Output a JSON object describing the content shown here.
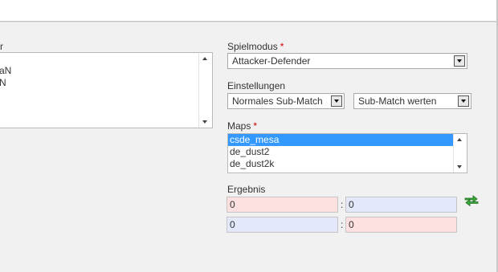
{
  "left_panel": {
    "label": "r",
    "list_items": [
      "",
      "aN",
      "N"
    ]
  },
  "spielmodus": {
    "label": "Spielmodus",
    "required": "*",
    "value": "Attacker-Defender"
  },
  "einstellungen": {
    "label": "Einstellungen",
    "submatch_mode": "Normales Sub-Match",
    "submatch_scoring": "Sub-Match werten"
  },
  "maps": {
    "label": "Maps",
    "required": "*",
    "items": [
      "csde_mesa",
      "de_dust2",
      "de_dust2k"
    ],
    "selected": "csde_mesa"
  },
  "ergebnis": {
    "label": "Ergebnis",
    "separator": ":",
    "row1": {
      "left": "0",
      "right": "0"
    },
    "row2": {
      "left": "0",
      "right": "0"
    }
  },
  "colors": {
    "selection": "#3399ff",
    "required": "#cc0000",
    "score_red": "#fde1e1",
    "score_blue": "#e3e9fa",
    "swap_icon": "#2e9a2e"
  },
  "icons": {
    "swap": "swap-sides-icon"
  }
}
